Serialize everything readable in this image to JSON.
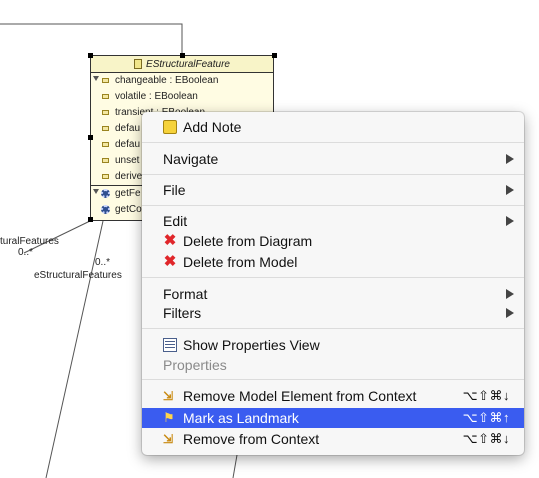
{
  "diagram": {
    "class_name": "EStructuralFeature",
    "attributes": [
      "changeable : EBoolean",
      "volatile : EBoolean",
      "transient : EBoolean",
      "defau",
      "defau",
      "unset",
      "derive"
    ],
    "operations": [
      "getFe",
      "getCo"
    ],
    "label_features_left": "turalFeatures",
    "label_mult_left": "0..*",
    "label_mult_mid": "0..*",
    "label_features_mid": "eStructuralFeatures"
  },
  "menu": {
    "add_note": "Add Note",
    "navigate": "Navigate",
    "file": "File",
    "edit": "Edit",
    "delete_from_diagram": "Delete from Diagram",
    "delete_from_model": "Delete from Model",
    "format": "Format",
    "filters": "Filters",
    "show_properties_view": "Show Properties View",
    "properties": "Properties",
    "remove_model_element": "Remove Model Element from Context",
    "remove_model_element_shortcut": "⌥⇧⌘↓",
    "mark_as_landmark": "Mark as Landmark",
    "mark_as_landmark_shortcut": "⌥⇧⌘↑",
    "remove_from_context": "Remove from Context",
    "remove_from_context_shortcut": "⌥⇧⌘↓"
  },
  "colors": {
    "selection": "#3a5cf0",
    "delete_icon": "#e0262a",
    "class_fill": "#fffce3"
  }
}
